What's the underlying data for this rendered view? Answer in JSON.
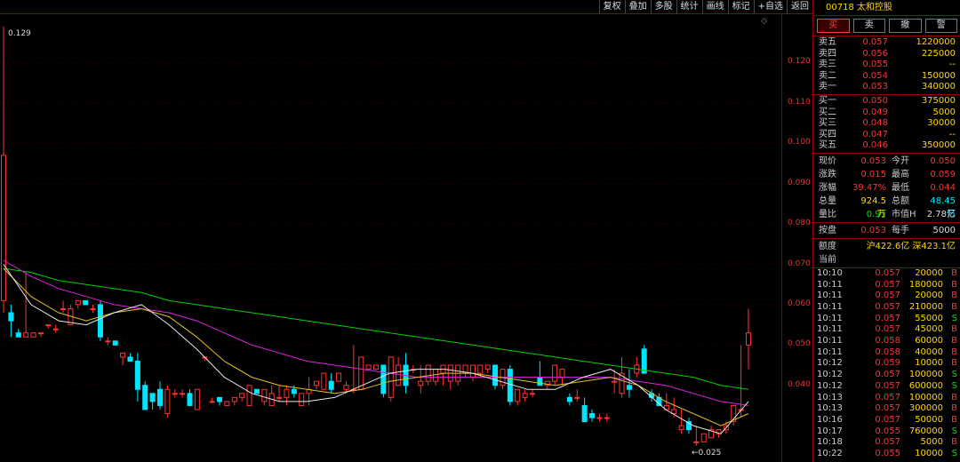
{
  "toolbar": [
    "复权",
    "叠加",
    "多股",
    "统计",
    "画线",
    "标记",
    "+自选",
    "返回"
  ],
  "price_axis": [
    "0.120",
    "0.110",
    "0.100",
    "0.090",
    "0.080",
    "0.070",
    "0.060",
    "0.050",
    "0.040"
  ],
  "chart": {
    "max_label": "0.129",
    "min_label": "←0.025",
    "candles": [
      {
        "o": 0.061,
        "h": 0.129,
        "l": 0.058,
        "c": 0.097
      },
      {
        "o": 0.058,
        "h": 0.06,
        "l": 0.052,
        "c": 0.056
      },
      {
        "o": 0.053,
        "h": 0.054,
        "l": 0.052,
        "c": 0.052
      },
      {
        "o": 0.052,
        "h": 0.068,
        "l": 0.052,
        "c": 0.053
      },
      {
        "o": 0.052,
        "h": 0.053,
        "l": 0.052,
        "c": 0.053
      },
      {
        "o": 0.053,
        "h": 0.053,
        "l": 0.052,
        "c": 0.053
      },
      {
        "o": 0.055,
        "h": 0.055,
        "l": 0.054,
        "c": 0.055
      },
      {
        "o": 0.054,
        "h": 0.055,
        "l": 0.053,
        "c": 0.054
      },
      {
        "o": 0.059,
        "h": 0.061,
        "l": 0.058,
        "c": 0.059
      },
      {
        "o": 0.055,
        "h": 0.06,
        "l": 0.055,
        "c": 0.059
      },
      {
        "o": 0.06,
        "h": 0.061,
        "l": 0.059,
        "c": 0.061
      },
      {
        "o": 0.061,
        "h": 0.061,
        "l": 0.06,
        "c": 0.06
      },
      {
        "o": 0.059,
        "h": 0.06,
        "l": 0.058,
        "c": 0.059
      },
      {
        "o": 0.06,
        "h": 0.061,
        "l": 0.051,
        "c": 0.052
      },
      {
        "o": 0.051,
        "h": 0.052,
        "l": 0.05,
        "c": 0.051
      },
      {
        "o": 0.051,
        "h": 0.051,
        "l": 0.05,
        "c": 0.05
      },
      {
        "o": 0.047,
        "h": 0.048,
        "l": 0.045,
        "c": 0.048
      },
      {
        "o": 0.047,
        "h": 0.048,
        "l": 0.046,
        "c": 0.046
      },
      {
        "o": 0.046,
        "h": 0.048,
        "l": 0.036,
        "c": 0.039
      },
      {
        "o": 0.04,
        "h": 0.041,
        "l": 0.034,
        "c": 0.034
      },
      {
        "o": 0.038,
        "h": 0.038,
        "l": 0.034,
        "c": 0.036
      },
      {
        "o": 0.039,
        "h": 0.041,
        "l": 0.034,
        "c": 0.035
      },
      {
        "o": 0.033,
        "h": 0.04,
        "l": 0.032,
        "c": 0.039
      },
      {
        "o": 0.038,
        "h": 0.039,
        "l": 0.037,
        "c": 0.038
      },
      {
        "o": 0.038,
        "h": 0.039,
        "l": 0.037,
        "c": 0.038
      },
      {
        "o": 0.038,
        "h": 0.039,
        "l": 0.035,
        "c": 0.035
      },
      {
        "o": 0.034,
        "h": 0.039,
        "l": 0.034,
        "c": 0.039
      },
      {
        "o": 0.047,
        "h": 0.047,
        "l": 0.046,
        "c": 0.047
      },
      {
        "o": 0.036,
        "h": 0.037,
        "l": 0.036,
        "c": 0.036
      },
      {
        "o": 0.037,
        "h": 0.037,
        "l": 0.035,
        "c": 0.036
      },
      {
        "o": 0.035,
        "h": 0.036,
        "l": 0.035,
        "c": 0.036
      },
      {
        "o": 0.036,
        "h": 0.037,
        "l": 0.035,
        "c": 0.037
      },
      {
        "o": 0.037,
        "h": 0.038,
        "l": 0.036,
        "c": 0.038
      },
      {
        "o": 0.035,
        "h": 0.04,
        "l": 0.035,
        "c": 0.04
      },
      {
        "o": 0.039,
        "h": 0.039,
        "l": 0.038,
        "c": 0.038
      },
      {
        "o": 0.036,
        "h": 0.039,
        "l": 0.035,
        "c": 0.039
      },
      {
        "o": 0.035,
        "h": 0.04,
        "l": 0.035,
        "c": 0.038
      },
      {
        "o": 0.037,
        "h": 0.04,
        "l": 0.036,
        "c": 0.037
      },
      {
        "o": 0.037,
        "h": 0.04,
        "l": 0.035,
        "c": 0.039
      },
      {
        "o": 0.039,
        "h": 0.04,
        "l": 0.037,
        "c": 0.038
      },
      {
        "o": 0.035,
        "h": 0.038,
        "l": 0.035,
        "c": 0.038
      },
      {
        "o": 0.038,
        "h": 0.042,
        "l": 0.035,
        "c": 0.039
      },
      {
        "o": 0.04,
        "h": 0.041,
        "l": 0.039,
        "c": 0.041
      },
      {
        "o": 0.039,
        "h": 0.043,
        "l": 0.039,
        "c": 0.043
      },
      {
        "o": 0.041,
        "h": 0.043,
        "l": 0.038,
        "c": 0.039
      },
      {
        "o": 0.041,
        "h": 0.043,
        "l": 0.041,
        "c": 0.043
      },
      {
        "o": 0.039,
        "h": 0.041,
        "l": 0.038,
        "c": 0.04
      },
      {
        "o": 0.039,
        "h": 0.05,
        "l": 0.038,
        "c": 0.039
      },
      {
        "o": 0.039,
        "h": 0.047,
        "l": 0.039,
        "c": 0.047
      },
      {
        "o": 0.044,
        "h": 0.045,
        "l": 0.044,
        "c": 0.045
      },
      {
        "o": 0.044,
        "h": 0.045,
        "l": 0.044,
        "c": 0.045
      },
      {
        "o": 0.045,
        "h": 0.045,
        "l": 0.037,
        "c": 0.038
      },
      {
        "o": 0.037,
        "h": 0.047,
        "l": 0.036,
        "c": 0.047
      },
      {
        "o": 0.04,
        "h": 0.047,
        "l": 0.04,
        "c": 0.045
      },
      {
        "o": 0.045,
        "h": 0.048,
        "l": 0.038,
        "c": 0.04
      },
      {
        "o": 0.044,
        "h": 0.045,
        "l": 0.043,
        "c": 0.044
      },
      {
        "o": 0.04,
        "h": 0.045,
        "l": 0.038,
        "c": 0.041
      },
      {
        "o": 0.041,
        "h": 0.045,
        "l": 0.04,
        "c": 0.045
      },
      {
        "o": 0.041,
        "h": 0.044,
        "l": 0.04,
        "c": 0.044
      },
      {
        "o": 0.043,
        "h": 0.045,
        "l": 0.04,
        "c": 0.045
      },
      {
        "o": 0.041,
        "h": 0.045,
        "l": 0.039,
        "c": 0.045
      },
      {
        "o": 0.041,
        "h": 0.045,
        "l": 0.04,
        "c": 0.045
      },
      {
        "o": 0.043,
        "h": 0.045,
        "l": 0.042,
        "c": 0.045
      },
      {
        "o": 0.042,
        "h": 0.045,
        "l": 0.041,
        "c": 0.045
      },
      {
        "o": 0.043,
        "h": 0.045,
        "l": 0.042,
        "c": 0.045
      },
      {
        "o": 0.044,
        "h": 0.045,
        "l": 0.043,
        "c": 0.045
      },
      {
        "o": 0.045,
        "h": 0.045,
        "l": 0.039,
        "c": 0.04
      },
      {
        "o": 0.04,
        "h": 0.044,
        "l": 0.039,
        "c": 0.044
      },
      {
        "o": 0.044,
        "h": 0.045,
        "l": 0.035,
        "c": 0.036
      },
      {
        "o": 0.036,
        "h": 0.039,
        "l": 0.035,
        "c": 0.039
      },
      {
        "o": 0.037,
        "h": 0.039,
        "l": 0.036,
        "c": 0.038
      },
      {
        "o": 0.038,
        "h": 0.039,
        "l": 0.037,
        "c": 0.038
      },
      {
        "o": 0.042,
        "h": 0.046,
        "l": 0.04,
        "c": 0.04
      },
      {
        "o": 0.04,
        "h": 0.041,
        "l": 0.039,
        "c": 0.041
      },
      {
        "o": 0.041,
        "h": 0.045,
        "l": 0.04,
        "c": 0.045
      },
      {
        "o": 0.042,
        "h": 0.044,
        "l": 0.04,
        "c": 0.044
      },
      {
        "o": 0.037,
        "h": 0.038,
        "l": 0.035,
        "c": 0.036
      },
      {
        "o": 0.037,
        "h": 0.039,
        "l": 0.036,
        "c": 0.037
      },
      {
        "o": 0.035,
        "h": 0.037,
        "l": 0.031,
        "c": 0.031
      },
      {
        "o": 0.033,
        "h": 0.034,
        "l": 0.031,
        "c": 0.032
      },
      {
        "o": 0.032,
        "h": 0.033,
        "l": 0.031,
        "c": 0.032
      },
      {
        "o": 0.032,
        "h": 0.033,
        "l": 0.031,
        "c": 0.032
      },
      {
        "o": 0.041,
        "h": 0.044,
        "l": 0.038,
        "c": 0.041
      },
      {
        "o": 0.038,
        "h": 0.047,
        "l": 0.037,
        "c": 0.043
      },
      {
        "o": 0.04,
        "h": 0.044,
        "l": 0.037,
        "c": 0.039
      },
      {
        "o": 0.043,
        "h": 0.047,
        "l": 0.042,
        "c": 0.045
      },
      {
        "o": 0.049,
        "h": 0.05,
        "l": 0.043,
        "c": 0.043
      },
      {
        "o": 0.038,
        "h": 0.039,
        "l": 0.036,
        "c": 0.037
      },
      {
        "o": 0.037,
        "h": 0.038,
        "l": 0.035,
        "c": 0.035
      },
      {
        "o": 0.034,
        "h": 0.038,
        "l": 0.034,
        "c": 0.035
      },
      {
        "o": 0.033,
        "h": 0.037,
        "l": 0.032,
        "c": 0.034
      },
      {
        "o": 0.029,
        "h": 0.034,
        "l": 0.028,
        "c": 0.03
      },
      {
        "o": 0.031,
        "h": 0.032,
        "l": 0.028,
        "c": 0.029
      },
      {
        "o": 0.026,
        "h": 0.03,
        "l": 0.025,
        "c": 0.026
      },
      {
        "o": 0.026,
        "h": 0.028,
        "l": 0.026,
        "c": 0.028
      },
      {
        "o": 0.027,
        "h": 0.03,
        "l": 0.027,
        "c": 0.029
      },
      {
        "o": 0.028,
        "h": 0.029,
        "l": 0.027,
        "c": 0.029
      },
      {
        "o": 0.029,
        "h": 0.031,
        "l": 0.028,
        "c": 0.03
      },
      {
        "o": 0.031,
        "h": 0.035,
        "l": 0.03,
        "c": 0.035
      },
      {
        "o": 0.034,
        "h": 0.05,
        "l": 0.032,
        "c": 0.034
      },
      {
        "o": 0.05,
        "h": 0.059,
        "l": 0.044,
        "c": 0.053
      }
    ],
    "ma_green": [
      0.069,
      0.068,
      0.066,
      0.065,
      0.064,
      0.063,
      0.061,
      0.06,
      0.059,
      0.058,
      0.057,
      0.056,
      0.055,
      0.054,
      0.053,
      0.052,
      0.051,
      0.05,
      0.049,
      0.048,
      0.047,
      0.046,
      0.045,
      0.044,
      0.043,
      0.042,
      0.04,
      0.039
    ],
    "ma_magenta": [
      0.071,
      0.067,
      0.064,
      0.062,
      0.06,
      0.059,
      0.058,
      0.056,
      0.053,
      0.05,
      0.048,
      0.046,
      0.045,
      0.044,
      0.043,
      0.042,
      0.042,
      0.042,
      0.042,
      0.042,
      0.042,
      0.042,
      0.042,
      0.041,
      0.04,
      0.038,
      0.036,
      0.035
    ],
    "ma_yellow": [
      0.069,
      0.062,
      0.058,
      0.056,
      0.058,
      0.059,
      0.057,
      0.052,
      0.046,
      0.042,
      0.04,
      0.039,
      0.038,
      0.039,
      0.041,
      0.042,
      0.043,
      0.043,
      0.042,
      0.041,
      0.04,
      0.041,
      0.042,
      0.04,
      0.036,
      0.033,
      0.03,
      0.033
    ],
    "ma_white": [
      0.07,
      0.06,
      0.056,
      0.055,
      0.058,
      0.06,
      0.055,
      0.049,
      0.042,
      0.038,
      0.036,
      0.036,
      0.037,
      0.04,
      0.043,
      0.044,
      0.044,
      0.043,
      0.041,
      0.039,
      0.039,
      0.042,
      0.044,
      0.04,
      0.034,
      0.03,
      0.028,
      0.036
    ]
  },
  "stock": {
    "code": "00718",
    "name": "太和控股"
  },
  "trade_buttons": [
    "买",
    "卖",
    "撤",
    "警"
  ],
  "asks": [
    {
      "label": "卖五",
      "price": "0.057",
      "vol": "1220000"
    },
    {
      "label": "卖四",
      "price": "0.056",
      "vol": "225000"
    },
    {
      "label": "卖三",
      "price": "0.055",
      "vol": "--"
    },
    {
      "label": "卖二",
      "price": "0.054",
      "vol": "150000"
    },
    {
      "label": "卖一",
      "price": "0.053",
      "vol": "340000"
    }
  ],
  "bids": [
    {
      "label": "买一",
      "price": "0.050",
      "vol": "375000"
    },
    {
      "label": "买二",
      "price": "0.049",
      "vol": "5000"
    },
    {
      "label": "买三",
      "price": "0.048",
      "vol": "30000"
    },
    {
      "label": "买四",
      "price": "0.047",
      "vol": "--"
    },
    {
      "label": "买五",
      "price": "0.046",
      "vol": "350000"
    }
  ],
  "quote": [
    {
      "k": "现价",
      "v": "0.053",
      "vc": "red",
      "k2": "今开",
      "v2": "0.050",
      "v2c": "red"
    },
    {
      "k": "涨跌",
      "v": "0.015",
      "vc": "red",
      "k2": "最高",
      "v2": "0.059",
      "v2c": "red"
    },
    {
      "k": "涨幅",
      "v": "39.47%",
      "vc": "red",
      "k2": "最低",
      "v2": "0.044",
      "v2c": "red"
    },
    {
      "k": "总量",
      "v": "924.5万",
      "vc": "yel",
      "k2": "总额",
      "v2": "48.45万",
      "v2c": "cyan"
    },
    {
      "k": "量比",
      "v": "0.91",
      "vc": "grn",
      "k2": "市值H",
      "v2": "2.78亿",
      "v2c": "wht"
    }
  ],
  "extra": {
    "k": "按盘",
    "v": "0.053",
    "k2": "每手",
    "v2": "5000"
  },
  "quota": {
    "label": "额度",
    "value": "沪422.6亿 深423.1亿",
    "label2": "当前"
  },
  "ticks": [
    {
      "t": "10:10",
      "p": "0.057",
      "v": "20000",
      "d": "B"
    },
    {
      "t": "10:11",
      "p": "0.057",
      "v": "180000",
      "d": "B"
    },
    {
      "t": "10:11",
      "p": "0.057",
      "v": "20000",
      "d": "B"
    },
    {
      "t": "10:11",
      "p": "0.057",
      "v": "210000",
      "d": "B"
    },
    {
      "t": "10:11",
      "p": "0.057",
      "v": "55000",
      "d": "S"
    },
    {
      "t": "10:11",
      "p": "0.057",
      "v": "45000",
      "d": "B"
    },
    {
      "t": "10:11",
      "p": "0.058",
      "v": "60000",
      "d": "B"
    },
    {
      "t": "10:11",
      "p": "0.058",
      "v": "40000",
      "d": "B"
    },
    {
      "t": "10:12",
      "p": "0.059",
      "v": "10000",
      "d": "B"
    },
    {
      "t": "10:12",
      "p": "0.057",
      "v": "100000",
      "d": "S"
    },
    {
      "t": "10:12",
      "p": "0.057",
      "v": "600000",
      "d": "S"
    },
    {
      "t": "10:13",
      "p": "0.057",
      "v": "100000",
      "d": "B"
    },
    {
      "t": "10:13",
      "p": "0.057",
      "v": "300000",
      "d": "B"
    },
    {
      "t": "10:16",
      "p": "0.057",
      "v": "50000",
      "d": "B"
    },
    {
      "t": "10:17",
      "p": "0.055",
      "v": "760000",
      "d": "S"
    },
    {
      "t": "10:18",
      "p": "0.057",
      "v": "5000",
      "d": "B"
    },
    {
      "t": "10:22",
      "p": "0.055",
      "v": "10000",
      "d": "S"
    }
  ],
  "colors": {
    "up": "#ff3232",
    "down": "#00e5ff",
    "ma_green": "#00d000",
    "ma_magenta": "#e020e0",
    "ma_yellow": "#e0c020",
    "ma_white": "#e8e8e8"
  }
}
